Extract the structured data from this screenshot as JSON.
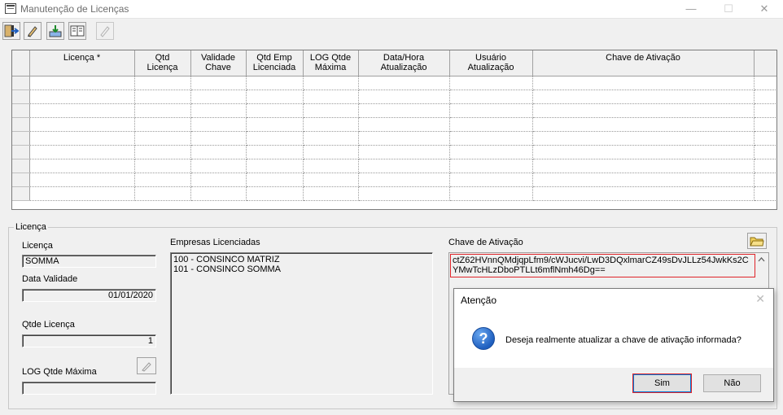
{
  "window": {
    "title": "Manutenção de Licenças",
    "minimize": "—",
    "maximize": "☐",
    "close": "✕"
  },
  "grid": {
    "columns": [
      {
        "l1": "",
        "l2": ""
      },
      {
        "l1": "Licença *",
        "l2": ""
      },
      {
        "l1": "Qtd",
        "l2": "Licença"
      },
      {
        "l1": "Validade",
        "l2": "Chave"
      },
      {
        "l1": "Qtd Emp",
        "l2": "Licenciada"
      },
      {
        "l1": "LOG Qtde",
        "l2": "Máxima"
      },
      {
        "l1": "Data/Hora",
        "l2": "Atualização"
      },
      {
        "l1": "Usuário",
        "l2": "Atualização"
      },
      {
        "l1": "Chave de Ativação",
        "l2": ""
      },
      {
        "l1": "",
        "l2": ""
      }
    ],
    "row_count": 9
  },
  "licenca": {
    "legend": "Licença",
    "licenca_label": "Licença",
    "licenca_value": "SOMMA",
    "data_validade_label": "Data Validade",
    "data_validade_value": "01/01/2020",
    "qtde_licenca_label": "Qtde Licença",
    "qtde_licenca_value": "1",
    "log_qtde_maxima_label": "LOG Qtde Máxima",
    "log_qtde_maxima_value": "",
    "empresas_label": "Empresas Licenciadas",
    "empresas": [
      "100 - CONSINCO MATRIZ",
      "101 - CONSINCO SOMMA"
    ],
    "chave_label": "Chave de Ativação",
    "chave_value": "ctZ62HVnnQMdjqpLfm9/cWJucvi/LwD3DQxlmarCZ49sDvJLLz54JwkKs2CYMwTcHLzDboPTLLt6mflNmh46Dg=="
  },
  "dialog": {
    "title": "Atenção",
    "close": "✕",
    "message": "Deseja realmente atualizar a chave de ativação informada?",
    "yes": "Sim",
    "no": "Não"
  }
}
